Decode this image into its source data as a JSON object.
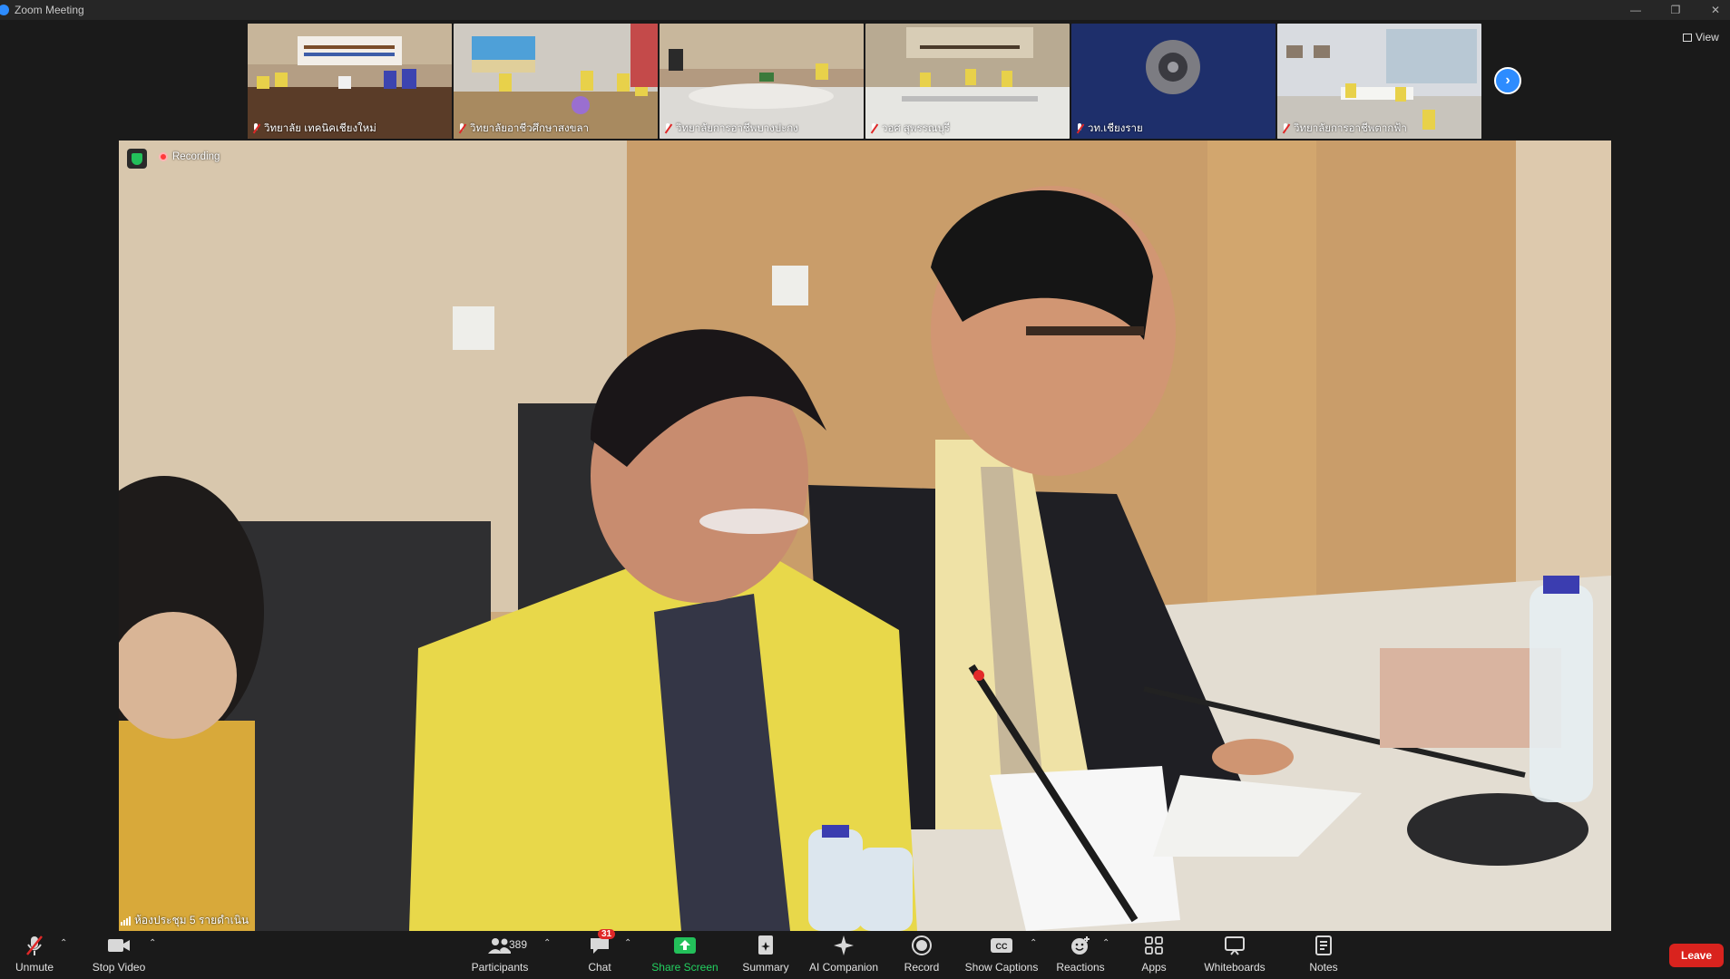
{
  "window": {
    "title": "Zoom Meeting"
  },
  "gallery": {
    "thumbnails": [
      {
        "name": "วิทยาลัย เทคนิคเชียงใหม่"
      },
      {
        "name": "วิทยาลัยอาชีวศึกษาสงขลา"
      },
      {
        "name": "วิทยาลัยการอาชีพบางปะกง"
      },
      {
        "name": "วอศ สุพรรณบุรี"
      },
      {
        "name": "วท.เชียงราย"
      },
      {
        "name": "วิทยาลัยการอาชีพตากฟ้า"
      }
    ],
    "view_label": "View"
  },
  "main": {
    "recording_label": "Recording",
    "room_name": "ห้องประชุม 5 รายดำเนิน"
  },
  "toolbar": {
    "unmute": "Unmute",
    "stop_video": "Stop Video",
    "participants": "Participants",
    "participants_count": "389",
    "chat": "Chat",
    "chat_badge": "31",
    "share_screen": "Share Screen",
    "summary": "Summary",
    "ai_companion": "AI Companion",
    "record": "Record",
    "show_captions": "Show Captions",
    "reactions": "Reactions",
    "apps": "Apps",
    "whiteboards": "Whiteboards",
    "notes": "Notes",
    "leave": "Leave"
  },
  "colors": {
    "accent": "#2d8cff",
    "leave": "#d9231e",
    "share": "#23d160",
    "badge": "#e02828"
  }
}
